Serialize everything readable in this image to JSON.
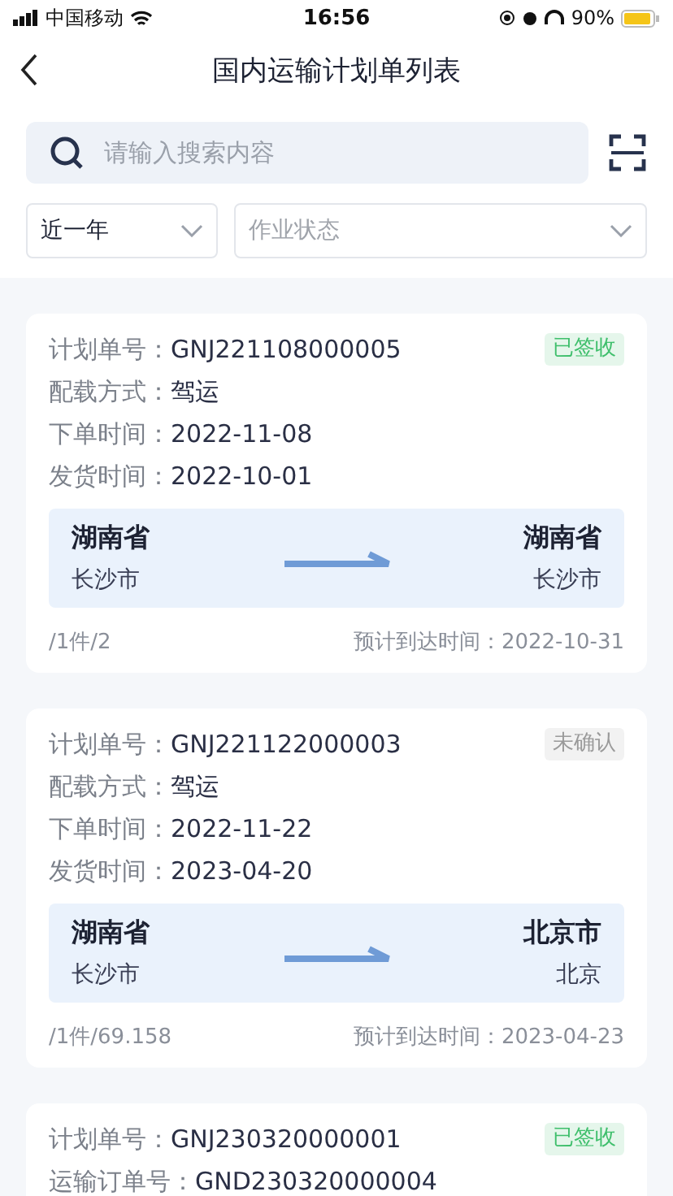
{
  "status_bar": {
    "carrier": "中国移动",
    "time": "16:56",
    "battery": "90%"
  },
  "header": {
    "title": "国内运输计划单列表"
  },
  "search": {
    "placeholder": "请输入搜索内容"
  },
  "filters": [
    {
      "value": "近一年"
    },
    {
      "placeholder": "作业状态"
    }
  ],
  "cards": [
    {
      "status": {
        "label": "已签收",
        "color": "#3fbf6c"
      },
      "fields": [
        {
          "label": "计划单号：",
          "value": "GNJ221108000005"
        },
        {
          "label": "配载方式：",
          "value": "驾运"
        },
        {
          "label": "下单时间：",
          "value": "2022-11-08"
        },
        {
          "label": "发货时间：",
          "value": "2022-10-01"
        }
      ],
      "route": {
        "from": {
          "province": "湖南省",
          "city": "长沙市"
        },
        "to": {
          "province": "湖南省",
          "city": "长沙市"
        }
      },
      "footer": {
        "quantity": "/1件/2",
        "eta_label": "预计到达时间：",
        "eta": "2022-10-31"
      }
    },
    {
      "status": {
        "label": "未确认",
        "color": "#9a9a9a"
      },
      "fields": [
        {
          "label": "计划单号：",
          "value": "GNJ221122000003"
        },
        {
          "label": "配载方式：",
          "value": "驾运"
        },
        {
          "label": "下单时间：",
          "value": "2022-11-22"
        },
        {
          "label": "发货时间：",
          "value": "2023-04-20"
        }
      ],
      "route": {
        "from": {
          "province": "湖南省",
          "city": "长沙市"
        },
        "to": {
          "province": "北京市",
          "city": "北京"
        }
      },
      "footer": {
        "quantity": "/1件/69.158",
        "eta_label": "预计到达时间：",
        "eta": "2023-04-23"
      }
    },
    {
      "status": {
        "label": "已签收",
        "color": "#3fbf6c"
      },
      "fields": [
        {
          "label": "计划单号：",
          "value": "GNJ230320000001"
        },
        {
          "label": "运输订单号：",
          "value": "GND230320000004"
        }
      ]
    }
  ]
}
